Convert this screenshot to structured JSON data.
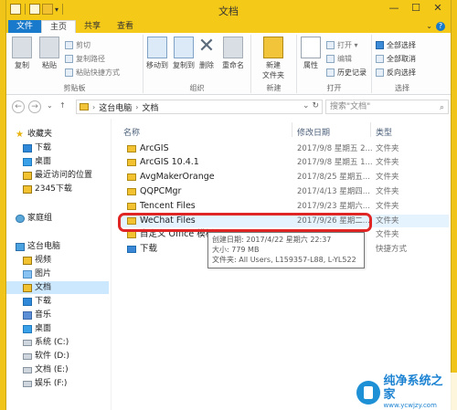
{
  "window": {
    "title": "文档",
    "buttons": {
      "minimize": "—",
      "maximize": "☐",
      "close": "✕"
    }
  },
  "ribbon_tabs": [
    "文件",
    "主页",
    "共享",
    "查看"
  ],
  "ribbon": {
    "clipboard": {
      "label": "剪贴板",
      "copy": "复制",
      "paste": "粘贴",
      "cut": "剪切",
      "copy_path": "复制路径",
      "paste_shortcut": "粘贴快捷方式"
    },
    "organize": {
      "label": "组织",
      "move_to": "移动到",
      "copy_to": "复制到",
      "delete": "删除",
      "rename": "重命名"
    },
    "new": {
      "label": "新建",
      "new_folder": "新建\n文件夹",
      "new_folder_line1": "新建",
      "new_folder_line2": "文件夹"
    },
    "open": {
      "label": "打开",
      "properties": "属性",
      "open": "打开 ▾",
      "edit": "编辑",
      "history": "历史记录"
    },
    "select": {
      "label": "选择",
      "select_all": "全部选择",
      "select_none": "全部取消",
      "invert": "反向选择"
    }
  },
  "address": {
    "crumbs": [
      "这台电脑",
      "文档"
    ],
    "search_placeholder": "搜索\"文档\""
  },
  "nav_pane": {
    "favorites": "收藏夹",
    "fav_items": [
      "下载",
      "桌面",
      "最近访问的位置",
      "2345下载"
    ],
    "homegroup": "家庭组",
    "this_pc": "这台电脑",
    "pc_items": [
      "视频",
      "图片",
      "文档",
      "下载",
      "音乐",
      "桌面",
      "系统 (C:)",
      "软件 (D:)",
      "文档 (E:)",
      "娱乐 (F:)"
    ]
  },
  "columns": {
    "name": "名称",
    "date": "修改日期",
    "type": "类型"
  },
  "files": [
    {
      "name": "ArcGIS",
      "date": "2017/9/8 星期五 2...",
      "type": "文件夹"
    },
    {
      "name": "ArcGIS 10.4.1",
      "date": "2017/9/8 星期五 1...",
      "type": "文件夹"
    },
    {
      "name": "AvgMakerOrange",
      "date": "2017/8/25 星期五...",
      "type": "文件夹"
    },
    {
      "name": "QQPCMgr",
      "date": "2017/4/13 星期四...",
      "type": "文件夹"
    },
    {
      "name": "Tencent Files",
      "date": "2017/9/23 星期六...",
      "type": "文件夹"
    },
    {
      "name": "WeChat Files",
      "date": "2017/9/26 星期二...",
      "type": "文件夹"
    },
    {
      "name": "自定义 Office 模板",
      "date": "",
      "type": "文件夹"
    },
    {
      "name": "下载",
      "date": "",
      "type": "快捷方式"
    }
  ],
  "tooltip": {
    "created": "创建日期: 2017/4/22 星期六 22:37",
    "size": "大小: 779 MB",
    "folders": "文件夹: All Users, L159357-L88, L-YL522"
  },
  "watermark": {
    "text": "纯净系统之家",
    "url": "www.ycwjzy.com"
  }
}
